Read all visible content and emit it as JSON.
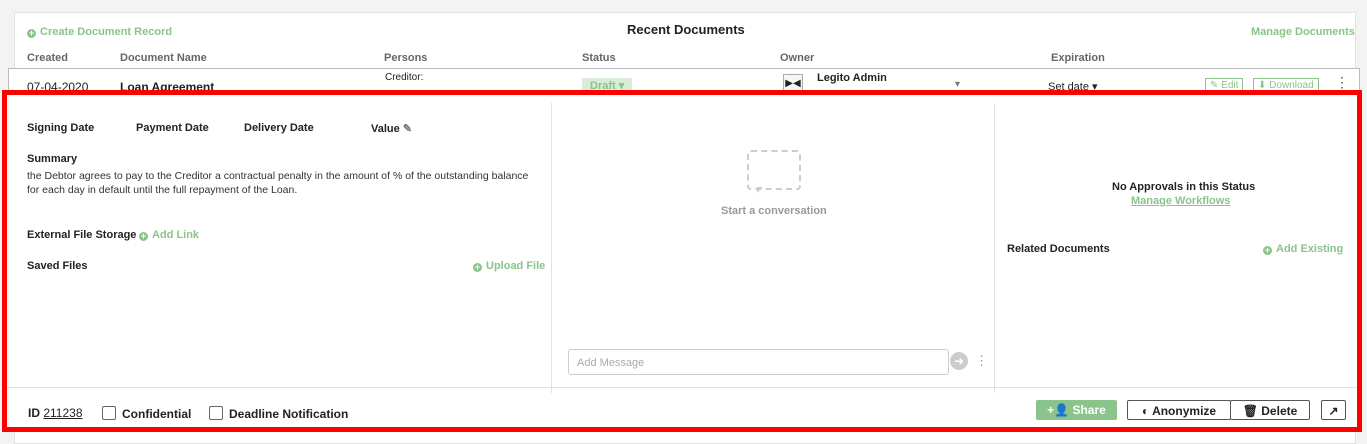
{
  "header": {
    "create_label": "Create Document Record",
    "title": "Recent Documents",
    "manage_label": "Manage Documents"
  },
  "columns": [
    "Created",
    "Document Name",
    "Persons",
    "Status",
    "Owner",
    "Expiration"
  ],
  "row": {
    "created": "07-04-2020",
    "name": "Loan Agreement",
    "persons": "Creditor:",
    "status": "Draft",
    "owner": "Legito Admin",
    "expiration": "Set date",
    "edit_label": "Edit",
    "download_label": "Download"
  },
  "details": {
    "signing_date": "Signing Date",
    "payment_date": "Payment Date",
    "delivery_date": "Delivery Date",
    "value": "Value",
    "summary_label": "Summary",
    "summary_text": "the Debtor agrees to pay to the Creditor a contractual penalty in the amount of % of the outstanding balance for each day in default until the full repayment of the Loan.",
    "external_storage": "External File Storage",
    "add_link": "Add Link",
    "saved_files": "Saved Files",
    "upload_file": "Upload File"
  },
  "conversation": {
    "empty_text": "Start a conversation",
    "placeholder": "Add Message"
  },
  "approvals": {
    "empty_text": "No Approvals in this Status",
    "manage_workflows": "Manage Workflows",
    "related_label": "Related Documents",
    "add_existing": "Add Existing"
  },
  "footer": {
    "id_label": "ID",
    "id_value": "211238",
    "confidential": "Confidential",
    "deadline": "Deadline Notification",
    "share": "Share",
    "anonymize": "Anonymize",
    "delete": "Delete"
  },
  "colors": {
    "accent": "#8bc48a",
    "highlight": "#ff0000",
    "share_bg": "#8bc48a"
  }
}
